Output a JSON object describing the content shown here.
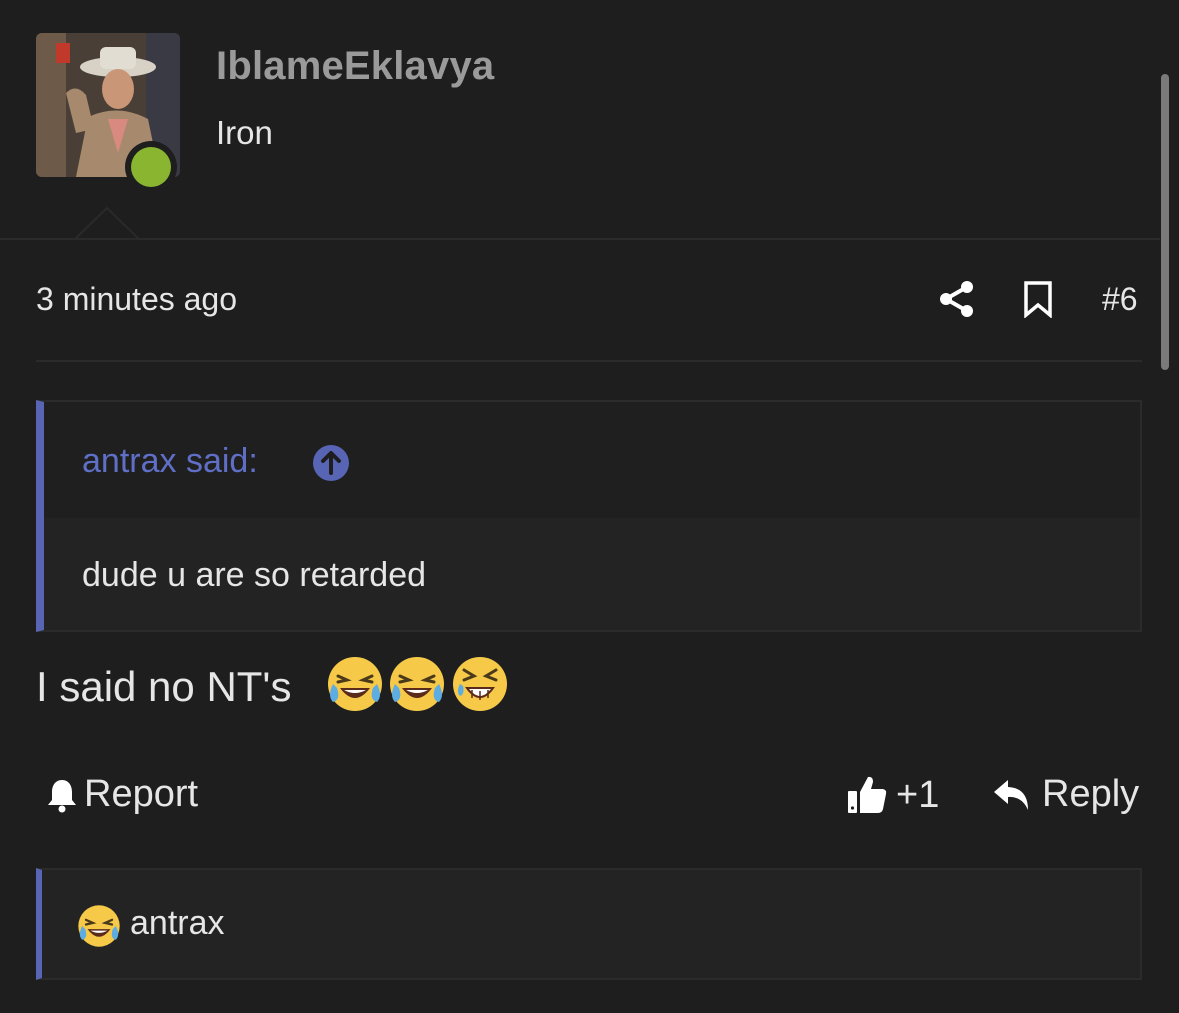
{
  "post": {
    "username": "IblameEklavya",
    "user_title": "Iron",
    "timestamp": "3 minutes ago",
    "post_number": "#6",
    "online_status_color": "#8ab531",
    "message_text": "I said no NT's",
    "message_emojis": [
      "laughing-crying-emoji",
      "laughing-crying-emoji",
      "squinting-laugh-emoji"
    ]
  },
  "quote": {
    "author_label": "antrax said:",
    "body": "dude u are so retarded",
    "accent_color": "#5865b5"
  },
  "actions": {
    "report_label": "Report",
    "like_count": "+1",
    "reply_label": "Reply"
  },
  "reactions": {
    "emoji": "laughing-crying-emoji",
    "users": "antrax"
  },
  "icons": {
    "share": "share-icon",
    "bookmark": "bookmark-icon",
    "quote_jump": "arrow-up-circle-icon",
    "report": "bell-icon",
    "like": "thumbs-up-icon",
    "reply": "reply-arrow-icon"
  }
}
